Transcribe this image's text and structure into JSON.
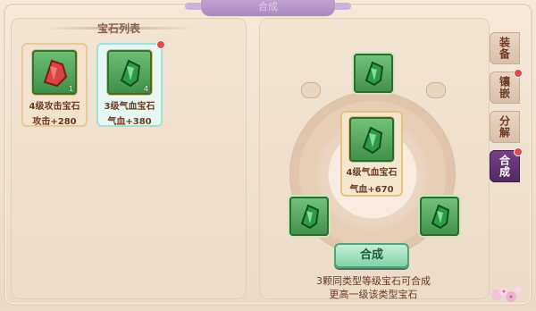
{
  "window": {
    "title": "合成"
  },
  "left_panel": {
    "title": "宝石列表",
    "gems": [
      {
        "name": "4级攻击宝石",
        "stat": "攻击+280",
        "count": "1",
        "color": "#d6453f",
        "has_badge": false
      },
      {
        "name": "3级气血宝石",
        "stat": "气血+380",
        "count": "4",
        "color": "#2e9b43",
        "has_badge": true
      }
    ]
  },
  "right_panel": {
    "center_gem": {
      "name": "4级气血宝石",
      "stat": "气血+670"
    },
    "synth_button": "合成",
    "description_lines": [
      "3颗同类型等级宝石可合成",
      "更高一级该类型宝石"
    ]
  },
  "side_tabs": [
    {
      "label": "装备",
      "active": false,
      "badge": false
    },
    {
      "label": "镶嵌",
      "active": false,
      "badge": true
    },
    {
      "label": "分解",
      "active": false,
      "badge": false
    },
    {
      "label": "合成",
      "active": true,
      "badge": true
    }
  ],
  "colors": {
    "panel_bg": "#f2e4d3",
    "accent_green": "#7fd0a6",
    "text_brown": "#6b3a22",
    "tab_active": "#4f2a5e",
    "badge_red": "#e24a4a"
  }
}
